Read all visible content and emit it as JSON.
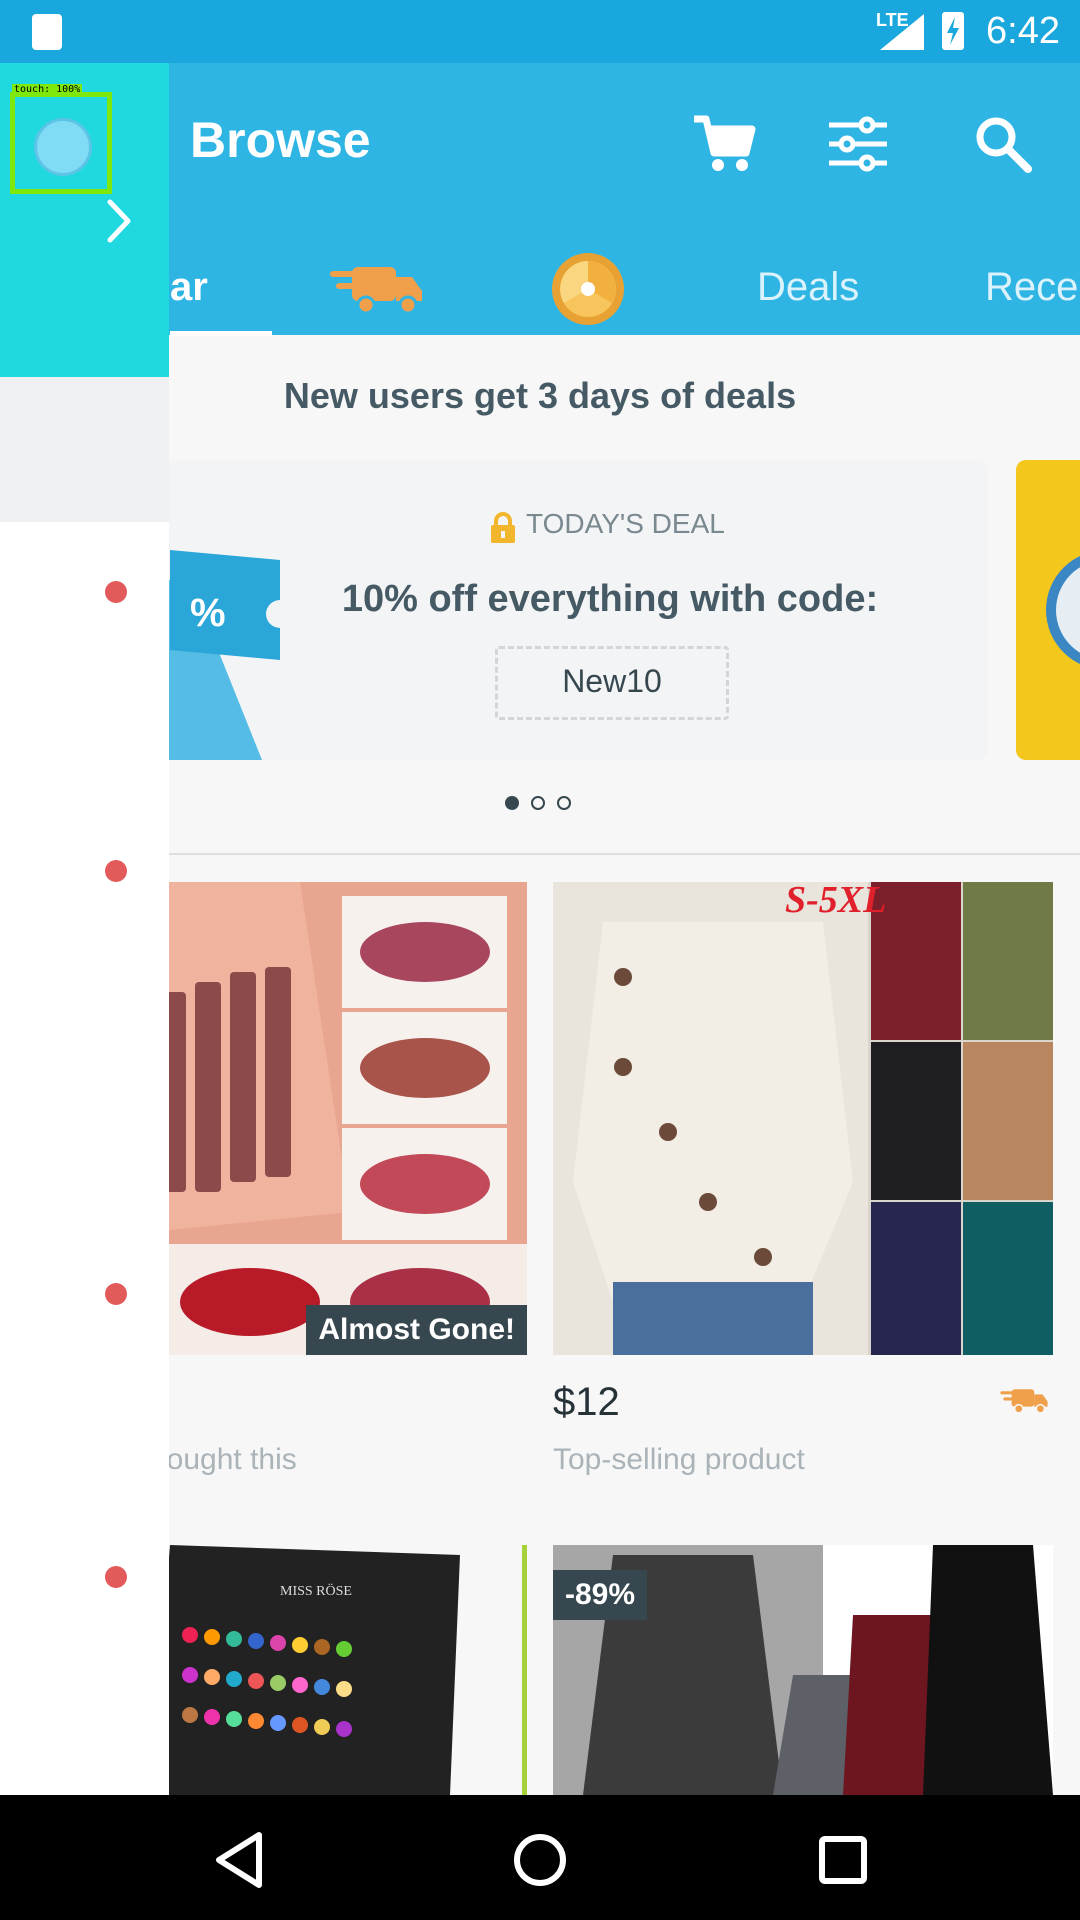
{
  "status_bar": {
    "network": "LTE",
    "time": "6:42"
  },
  "app_bar": {
    "title": "Browse",
    "icons": [
      "cart-icon",
      "filter-icon",
      "search-icon"
    ]
  },
  "tabs": [
    {
      "label": "ar",
      "selected": true
    },
    {
      "icon": "shipping-truck-icon"
    },
    {
      "icon": "prize-wheel-icon"
    },
    {
      "label": "Deals"
    },
    {
      "label": "Rece"
    }
  ],
  "promo": {
    "headline": "New users get 3 days of deals",
    "card": {
      "label": "TODAY'S DEAL",
      "title": "10% off everything with code:",
      "code": "New10"
    },
    "pagination": {
      "count": 3,
      "active": 0
    }
  },
  "products": [
    {
      "badge": "Almost Gone!",
      "subtitle": "bought this"
    },
    {
      "image_text": "S-5XL",
      "price": "$12",
      "subtitle": "Top-selling product"
    },
    {
      "image_text": "MISS RÖSE"
    },
    {
      "badge": "-89%"
    }
  ],
  "overlay": {
    "touch_label": "touch: 100%"
  },
  "colors": {
    "accent": "#2fb5e4",
    "status_bar": "#1aa7dd",
    "overlay": "#20d8e0",
    "badge": "#37474f",
    "shipping": "#f0a04b"
  }
}
